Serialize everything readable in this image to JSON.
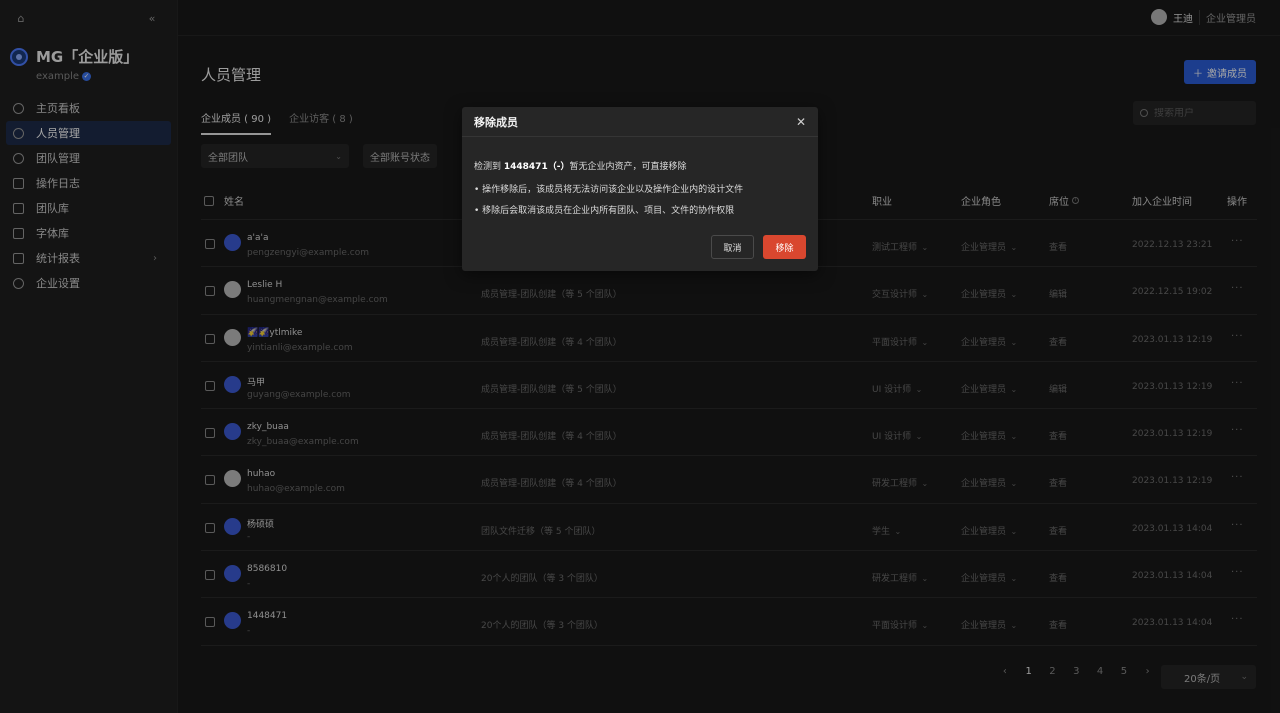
{
  "app": {
    "brand_name": "MG「企业版」",
    "brand_sub": "example"
  },
  "sidebar": {
    "items": [
      {
        "label": "主页看板",
        "icon": "dashboard-icon"
      },
      {
        "label": "人员管理",
        "icon": "person-icon",
        "active": true
      },
      {
        "label": "团队管理",
        "icon": "team-icon"
      },
      {
        "label": "操作日志",
        "icon": "log-icon"
      },
      {
        "label": "团队库",
        "icon": "library-icon"
      },
      {
        "label": "字体库",
        "icon": "font-icon"
      },
      {
        "label": "统计报表",
        "icon": "chart-icon",
        "has_children": true
      },
      {
        "label": "企业设置",
        "icon": "settings-icon"
      }
    ]
  },
  "topbar": {
    "user_name": "王迪",
    "user_role": "企业管理员"
  },
  "main": {
    "title": "人员管理",
    "invite_label": "邀请成员",
    "tabs": [
      {
        "label": "企业成员 ( 90 )",
        "active": true
      },
      {
        "label": "企业访客 ( 8 )",
        "active": false
      }
    ],
    "search_placeholder": "搜索用户",
    "filters": {
      "team": "全部团队",
      "status": "全部账号状态"
    }
  },
  "table": {
    "headers": {
      "name": "姓名",
      "job": "职业",
      "role": "企业角色",
      "seat": "席位",
      "joined": "加入企业时间",
      "op": "操作"
    },
    "rows": [
      {
        "name": "a'a'a",
        "email": "pengzengyi@example.com",
        "team": "",
        "job": "测试工程师",
        "role": "企业管理员",
        "seat": "查看",
        "joined": "2022.12.13 23:21",
        "avatar": "blue"
      },
      {
        "name": "Leslie H",
        "email": "huangmengnan@example.com",
        "team": "成员管理-团队创建（等 5 个团队）",
        "job": "交互设计师",
        "role": "企业管理员",
        "seat": "编辑",
        "joined": "2022.12.15 19:02",
        "avatar": "img"
      },
      {
        "name": "🌠🌠ytlmike",
        "email": "yintianli@example.com",
        "team": "成员管理-团队创建（等 4 个团队）",
        "job": "平面设计师",
        "role": "企业管理员",
        "seat": "查看",
        "joined": "2023.01.13 12:19",
        "avatar": "img"
      },
      {
        "name": "马甲",
        "email": "guyang@example.com",
        "team": "成员管理-团队创建（等 5 个团队）",
        "job": "UI 设计师",
        "role": "企业管理员",
        "seat": "编辑",
        "joined": "2023.01.13 12:19",
        "avatar": "blue"
      },
      {
        "name": "zky_buaa",
        "email": "zky_buaa@example.com",
        "team": "成员管理-团队创建（等 4 个团队）",
        "job": "UI 设计师",
        "role": "企业管理员",
        "seat": "查看",
        "joined": "2023.01.13 12:19",
        "avatar": "blue"
      },
      {
        "name": "huhao",
        "email": "huhao@example.com",
        "team": "成员管理-团队创建（等 4 个团队）",
        "job": "研发工程师",
        "role": "企业管理员",
        "seat": "查看",
        "joined": "2023.01.13 12:19",
        "avatar": "img"
      },
      {
        "name": "杨硕硕",
        "email": "-",
        "team": "团队文件迁移（等 5 个团队）",
        "job": "学生",
        "role": "企业管理员",
        "seat": "查看",
        "joined": "2023.01.13 14:04",
        "avatar": "blue"
      },
      {
        "name": "8586810",
        "email": "-",
        "team": "20个人的团队（等 3 个团队）",
        "job": "研发工程师",
        "role": "企业管理员",
        "seat": "查看",
        "joined": "2023.01.13 14:04",
        "avatar": "blue"
      },
      {
        "name": "1448471",
        "email": "-",
        "team": "20个人的团队（等 3 个团队）",
        "job": "平面设计师",
        "role": "企业管理员",
        "seat": "查看",
        "joined": "2023.01.13 14:04",
        "avatar": "blue"
      }
    ],
    "op_label": "···"
  },
  "pagination": {
    "prev": "‹",
    "pages": [
      "1",
      "2",
      "3",
      "4",
      "5"
    ],
    "current": "1",
    "next": "›",
    "page_size": "20条/页"
  },
  "modal": {
    "title": "移除成员",
    "line1_prefix": "检测到 ",
    "line1_user": "1448471（-）",
    "line1_suffix": "暂无企业内资产，可直接移除",
    "bullet1": "• 操作移除后，该成员将无法访问该企业以及操作企业内的设计文件",
    "bullet2": "• 移除后会取消该成员在企业内所有团队、项目、文件的协作权限",
    "cancel_label": "取消",
    "confirm_label": "移除"
  },
  "colors": {
    "accent": "#2c5fd9",
    "danger": "#d9472f",
    "background": "#1a1a1a"
  }
}
